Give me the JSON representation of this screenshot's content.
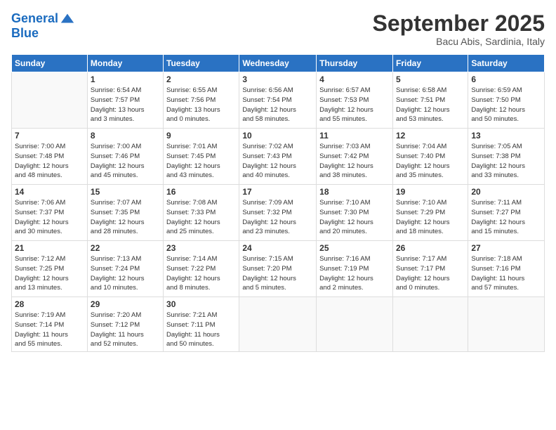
{
  "logo": {
    "line1": "General",
    "line2": "Blue"
  },
  "title": "September 2025",
  "subtitle": "Bacu Abis, Sardinia, Italy",
  "days_of_week": [
    "Sunday",
    "Monday",
    "Tuesday",
    "Wednesday",
    "Thursday",
    "Friday",
    "Saturday"
  ],
  "weeks": [
    [
      {
        "num": "",
        "info": ""
      },
      {
        "num": "1",
        "info": "Sunrise: 6:54 AM\nSunset: 7:57 PM\nDaylight: 13 hours\nand 3 minutes."
      },
      {
        "num": "2",
        "info": "Sunrise: 6:55 AM\nSunset: 7:56 PM\nDaylight: 13 hours\nand 0 minutes."
      },
      {
        "num": "3",
        "info": "Sunrise: 6:56 AM\nSunset: 7:54 PM\nDaylight: 12 hours\nand 58 minutes."
      },
      {
        "num": "4",
        "info": "Sunrise: 6:57 AM\nSunset: 7:53 PM\nDaylight: 12 hours\nand 55 minutes."
      },
      {
        "num": "5",
        "info": "Sunrise: 6:58 AM\nSunset: 7:51 PM\nDaylight: 12 hours\nand 53 minutes."
      },
      {
        "num": "6",
        "info": "Sunrise: 6:59 AM\nSunset: 7:50 PM\nDaylight: 12 hours\nand 50 minutes."
      }
    ],
    [
      {
        "num": "7",
        "info": "Sunrise: 7:00 AM\nSunset: 7:48 PM\nDaylight: 12 hours\nand 48 minutes."
      },
      {
        "num": "8",
        "info": "Sunrise: 7:00 AM\nSunset: 7:46 PM\nDaylight: 12 hours\nand 45 minutes."
      },
      {
        "num": "9",
        "info": "Sunrise: 7:01 AM\nSunset: 7:45 PM\nDaylight: 12 hours\nand 43 minutes."
      },
      {
        "num": "10",
        "info": "Sunrise: 7:02 AM\nSunset: 7:43 PM\nDaylight: 12 hours\nand 40 minutes."
      },
      {
        "num": "11",
        "info": "Sunrise: 7:03 AM\nSunset: 7:42 PM\nDaylight: 12 hours\nand 38 minutes."
      },
      {
        "num": "12",
        "info": "Sunrise: 7:04 AM\nSunset: 7:40 PM\nDaylight: 12 hours\nand 35 minutes."
      },
      {
        "num": "13",
        "info": "Sunrise: 7:05 AM\nSunset: 7:38 PM\nDaylight: 12 hours\nand 33 minutes."
      }
    ],
    [
      {
        "num": "14",
        "info": "Sunrise: 7:06 AM\nSunset: 7:37 PM\nDaylight: 12 hours\nand 30 minutes."
      },
      {
        "num": "15",
        "info": "Sunrise: 7:07 AM\nSunset: 7:35 PM\nDaylight: 12 hours\nand 28 minutes."
      },
      {
        "num": "16",
        "info": "Sunrise: 7:08 AM\nSunset: 7:33 PM\nDaylight: 12 hours\nand 25 minutes."
      },
      {
        "num": "17",
        "info": "Sunrise: 7:09 AM\nSunset: 7:32 PM\nDaylight: 12 hours\nand 23 minutes."
      },
      {
        "num": "18",
        "info": "Sunrise: 7:10 AM\nSunset: 7:30 PM\nDaylight: 12 hours\nand 20 minutes."
      },
      {
        "num": "19",
        "info": "Sunrise: 7:10 AM\nSunset: 7:29 PM\nDaylight: 12 hours\nand 18 minutes."
      },
      {
        "num": "20",
        "info": "Sunrise: 7:11 AM\nSunset: 7:27 PM\nDaylight: 12 hours\nand 15 minutes."
      }
    ],
    [
      {
        "num": "21",
        "info": "Sunrise: 7:12 AM\nSunset: 7:25 PM\nDaylight: 12 hours\nand 13 minutes."
      },
      {
        "num": "22",
        "info": "Sunrise: 7:13 AM\nSunset: 7:24 PM\nDaylight: 12 hours\nand 10 minutes."
      },
      {
        "num": "23",
        "info": "Sunrise: 7:14 AM\nSunset: 7:22 PM\nDaylight: 12 hours\nand 8 minutes."
      },
      {
        "num": "24",
        "info": "Sunrise: 7:15 AM\nSunset: 7:20 PM\nDaylight: 12 hours\nand 5 minutes."
      },
      {
        "num": "25",
        "info": "Sunrise: 7:16 AM\nSunset: 7:19 PM\nDaylight: 12 hours\nand 2 minutes."
      },
      {
        "num": "26",
        "info": "Sunrise: 7:17 AM\nSunset: 7:17 PM\nDaylight: 12 hours\nand 0 minutes."
      },
      {
        "num": "27",
        "info": "Sunrise: 7:18 AM\nSunset: 7:16 PM\nDaylight: 11 hours\nand 57 minutes."
      }
    ],
    [
      {
        "num": "28",
        "info": "Sunrise: 7:19 AM\nSunset: 7:14 PM\nDaylight: 11 hours\nand 55 minutes."
      },
      {
        "num": "29",
        "info": "Sunrise: 7:20 AM\nSunset: 7:12 PM\nDaylight: 11 hours\nand 52 minutes."
      },
      {
        "num": "30",
        "info": "Sunrise: 7:21 AM\nSunset: 7:11 PM\nDaylight: 11 hours\nand 50 minutes."
      },
      {
        "num": "",
        "info": ""
      },
      {
        "num": "",
        "info": ""
      },
      {
        "num": "",
        "info": ""
      },
      {
        "num": "",
        "info": ""
      }
    ]
  ]
}
